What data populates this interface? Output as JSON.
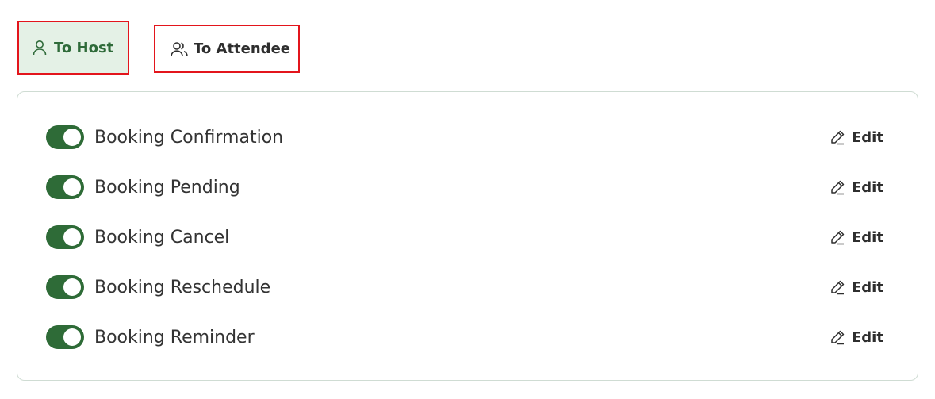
{
  "tabs": {
    "host": {
      "label": "To Host",
      "icon": "user-icon",
      "active": true
    },
    "attendee": {
      "label": "To Attendee",
      "icon": "users-icon",
      "active": false
    }
  },
  "notifications": [
    {
      "label": "Booking Confirmation",
      "enabled": true,
      "edit_label": "Edit"
    },
    {
      "label": "Booking Pending",
      "enabled": true,
      "edit_label": "Edit"
    },
    {
      "label": "Booking Cancel",
      "enabled": true,
      "edit_label": "Edit"
    },
    {
      "label": "Booking Reschedule",
      "enabled": true,
      "edit_label": "Edit"
    },
    {
      "label": "Booking Reminder",
      "enabled": true,
      "edit_label": "Edit"
    }
  ],
  "colors": {
    "accent": "#2e6b37",
    "active_tab_bg": "#e4f1e6",
    "highlight_border": "#e3151c",
    "panel_border": "#cfdcd3"
  }
}
